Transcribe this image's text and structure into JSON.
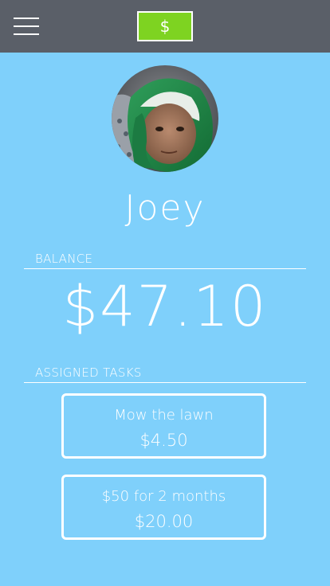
{
  "header": {
    "menu_icon": "hamburger-menu-icon",
    "dollar_label": "$",
    "dollar_button_color": "#7ed321",
    "bar_color": "#5a5f68"
  },
  "profile": {
    "name": "Joey",
    "avatar_icon": "child-avatar-photo"
  },
  "balance": {
    "label": "BALANCE",
    "amount": "$47.10"
  },
  "tasks": {
    "label": "ASSIGNED TASKS",
    "items": [
      {
        "title": "Mow the lawn",
        "amount": "$4.50"
      },
      {
        "title": "$50 for 2 months",
        "amount": "$20.00"
      }
    ]
  },
  "colors": {
    "background": "#7fd0fb",
    "text": "#ffffff"
  }
}
